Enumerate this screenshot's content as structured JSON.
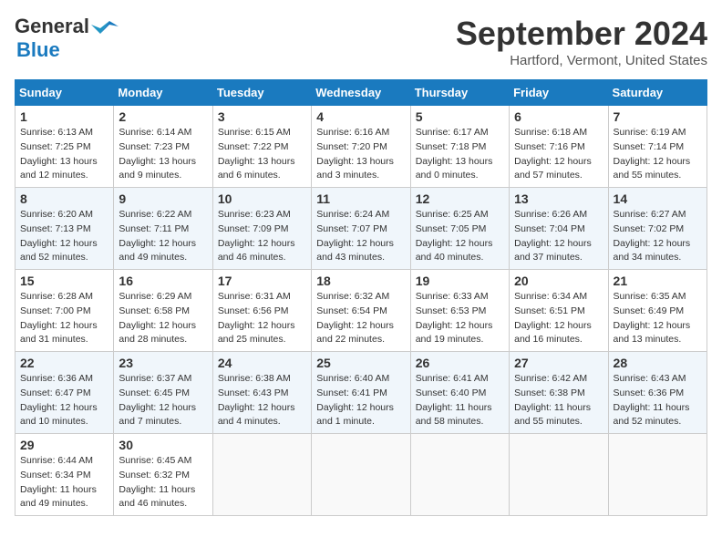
{
  "header": {
    "logo_line1": "General",
    "logo_line2": "Blue",
    "month": "September 2024",
    "location": "Hartford, Vermont, United States"
  },
  "days_of_week": [
    "Sunday",
    "Monday",
    "Tuesday",
    "Wednesday",
    "Thursday",
    "Friday",
    "Saturday"
  ],
  "weeks": [
    [
      {
        "day": "1",
        "sunrise": "6:13 AM",
        "sunset": "7:25 PM",
        "daylight": "13 hours and 12 minutes."
      },
      {
        "day": "2",
        "sunrise": "6:14 AM",
        "sunset": "7:23 PM",
        "daylight": "13 hours and 9 minutes."
      },
      {
        "day": "3",
        "sunrise": "6:15 AM",
        "sunset": "7:22 PM",
        "daylight": "13 hours and 6 minutes."
      },
      {
        "day": "4",
        "sunrise": "6:16 AM",
        "sunset": "7:20 PM",
        "daylight": "13 hours and 3 minutes."
      },
      {
        "day": "5",
        "sunrise": "6:17 AM",
        "sunset": "7:18 PM",
        "daylight": "13 hours and 0 minutes."
      },
      {
        "day": "6",
        "sunrise": "6:18 AM",
        "sunset": "7:16 PM",
        "daylight": "12 hours and 57 minutes."
      },
      {
        "day": "7",
        "sunrise": "6:19 AM",
        "sunset": "7:14 PM",
        "daylight": "12 hours and 55 minutes."
      }
    ],
    [
      {
        "day": "8",
        "sunrise": "6:20 AM",
        "sunset": "7:13 PM",
        "daylight": "12 hours and 52 minutes."
      },
      {
        "day": "9",
        "sunrise": "6:22 AM",
        "sunset": "7:11 PM",
        "daylight": "12 hours and 49 minutes."
      },
      {
        "day": "10",
        "sunrise": "6:23 AM",
        "sunset": "7:09 PM",
        "daylight": "12 hours and 46 minutes."
      },
      {
        "day": "11",
        "sunrise": "6:24 AM",
        "sunset": "7:07 PM",
        "daylight": "12 hours and 43 minutes."
      },
      {
        "day": "12",
        "sunrise": "6:25 AM",
        "sunset": "7:05 PM",
        "daylight": "12 hours and 40 minutes."
      },
      {
        "day": "13",
        "sunrise": "6:26 AM",
        "sunset": "7:04 PM",
        "daylight": "12 hours and 37 minutes."
      },
      {
        "day": "14",
        "sunrise": "6:27 AM",
        "sunset": "7:02 PM",
        "daylight": "12 hours and 34 minutes."
      }
    ],
    [
      {
        "day": "15",
        "sunrise": "6:28 AM",
        "sunset": "7:00 PM",
        "daylight": "12 hours and 31 minutes."
      },
      {
        "day": "16",
        "sunrise": "6:29 AM",
        "sunset": "6:58 PM",
        "daylight": "12 hours and 28 minutes."
      },
      {
        "day": "17",
        "sunrise": "6:31 AM",
        "sunset": "6:56 PM",
        "daylight": "12 hours and 25 minutes."
      },
      {
        "day": "18",
        "sunrise": "6:32 AM",
        "sunset": "6:54 PM",
        "daylight": "12 hours and 22 minutes."
      },
      {
        "day": "19",
        "sunrise": "6:33 AM",
        "sunset": "6:53 PM",
        "daylight": "12 hours and 19 minutes."
      },
      {
        "day": "20",
        "sunrise": "6:34 AM",
        "sunset": "6:51 PM",
        "daylight": "12 hours and 16 minutes."
      },
      {
        "day": "21",
        "sunrise": "6:35 AM",
        "sunset": "6:49 PM",
        "daylight": "12 hours and 13 minutes."
      }
    ],
    [
      {
        "day": "22",
        "sunrise": "6:36 AM",
        "sunset": "6:47 PM",
        "daylight": "12 hours and 10 minutes."
      },
      {
        "day": "23",
        "sunrise": "6:37 AM",
        "sunset": "6:45 PM",
        "daylight": "12 hours and 7 minutes."
      },
      {
        "day": "24",
        "sunrise": "6:38 AM",
        "sunset": "6:43 PM",
        "daylight": "12 hours and 4 minutes."
      },
      {
        "day": "25",
        "sunrise": "6:40 AM",
        "sunset": "6:41 PM",
        "daylight": "12 hours and 1 minute."
      },
      {
        "day": "26",
        "sunrise": "6:41 AM",
        "sunset": "6:40 PM",
        "daylight": "11 hours and 58 minutes."
      },
      {
        "day": "27",
        "sunrise": "6:42 AM",
        "sunset": "6:38 PM",
        "daylight": "11 hours and 55 minutes."
      },
      {
        "day": "28",
        "sunrise": "6:43 AM",
        "sunset": "6:36 PM",
        "daylight": "11 hours and 52 minutes."
      }
    ],
    [
      {
        "day": "29",
        "sunrise": "6:44 AM",
        "sunset": "6:34 PM",
        "daylight": "11 hours and 49 minutes."
      },
      {
        "day": "30",
        "sunrise": "6:45 AM",
        "sunset": "6:32 PM",
        "daylight": "11 hours and 46 minutes."
      },
      null,
      null,
      null,
      null,
      null
    ]
  ]
}
